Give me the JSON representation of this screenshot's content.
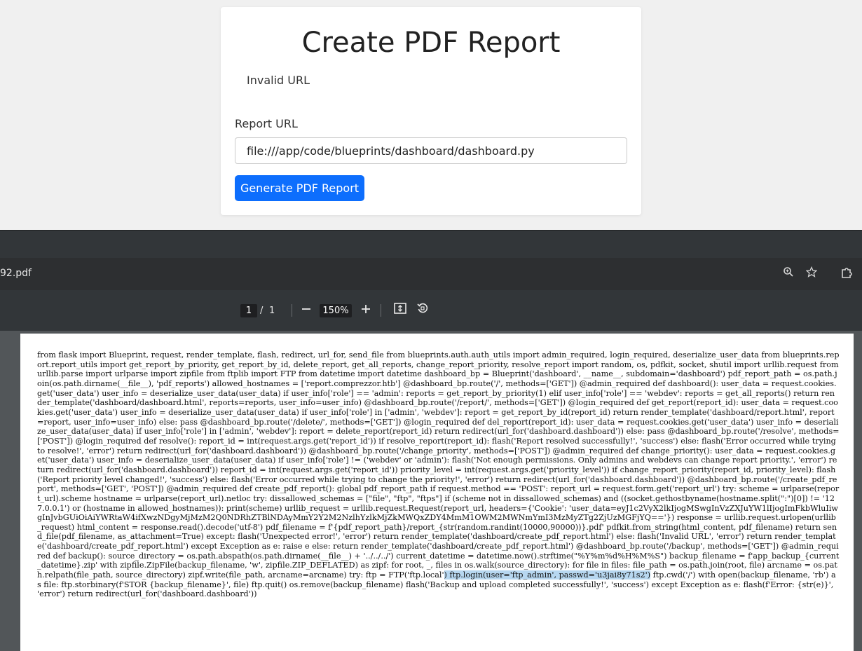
{
  "page": {
    "title": "Create PDF Report",
    "alert_text": "Invalid URL",
    "report_url_label": "Report URL",
    "report_url_value": "file:///app/code/blueprints/dashboard/dashboard.py",
    "generate_button_label": "Generate PDF Report",
    "accent_color": "#0d6efd"
  },
  "pdf_viewer": {
    "filename": "92.pdf",
    "current_page": "1",
    "page_separator": "/",
    "total_pages": "1",
    "zoom": "150%",
    "icons": [
      "zoom-icon",
      "star-icon",
      "extensions-icon",
      "zoom-out-icon",
      "zoom-in-icon",
      "fit-page-icon",
      "rotate-icon"
    ],
    "content_before_highlight": "from flask import Blueprint, request, render_template, flash, redirect, url_for, send_file from blueprints.auth.auth_utils import admin_required, login_required, deserialize_user_data from blueprints.report.report_utils import get_report_by_priority, get_report_by_id, delete_report, get_all_reports, change_report_priority, resolve_report import random, os, pdfkit, socket, shutil import urllib.request from urllib.parse import urlparse import zipfile from ftplib import FTP from datetime import datetime dashboard_bp = Blueprint('dashboard', __name__, subdomain='dashboard') pdf_report_path = os.path.join(os.path.dirname(__file__), 'pdf_reports') allowed_hostnames = ['report.comprezzor.htb'] @dashboard_bp.route('/', methods=['GET']) @admin_required def dashboard(): user_data = request.cookies.get('user_data') user_info = deserialize_user_data(user_data) if user_info['role'] == 'admin': reports = get_report_by_priority(1) elif user_info['role'] == 'webdev': reports = get_all_reports() return render_template('dashboard/dashboard.html', reports=reports, user_info=user_info) @dashboard_bp.route('/report/', methods=['GET']) @login_required def get_report(report_id): user_data = request.cookies.get('user_data') user_info = deserialize_user_data(user_data) if user_info['role'] in ['admin', 'webdev']: report = get_report_by_id(report_id) return render_template('dashboard/report.html', report=report, user_info=user_info) else: pass @dashboard_bp.route('/delete/', methods=['GET']) @login_required def del_report(report_id): user_data = request.cookies.get('user_data') user_info = deserialize_user_data(user_data) if user_info['role'] in ['admin', 'webdev']: report = delete_report(report_id) return redirect(url_for('dashboard.dashboard')) else: pass @dashboard_bp.route('/resolve', methods=['POST']) @login_required def resolve(): report_id = int(request.args.get('report_id')) if resolve_report(report_id): flash('Report resolved successfully!', 'success') else: flash('Error occurred while trying to resolve!', 'error') return redirect(url_for('dashboard.dashboard')) @dashboard_bp.route('/change_priority', methods=['POST']) @admin_required def change_priority(): user_data = request.cookies.get('user_data') user_info = deserialize_user_data(user_data) if user_info['role'] != ('webdev' or 'admin'): flash('Not enough permissions. Only admins and webdevs can change report priority.', 'error') return redirect(url_for('dashboard.dashboard')) report_id = int(request.args.get('report_id')) priority_level = int(request.args.get('priority_level')) if change_report_priority(report_id, priority_level): flash('Report priority level changed!', 'success') else: flash('Error occurred while trying to change the priority!', 'error') return redirect(url_for('dashboard.dashboard')) @dashboard_bp.route('/create_pdf_report', methods=['GET', 'POST']) @admin_required def create_pdf_report(): global pdf_report_path if request.method == 'POST': report_url = request.form.get('report_url') try: scheme = urlparse(report_url).scheme hostname = urlparse(report_url).netloc try: dissallowed_schemas = [\"file\", \"ftp\", \"ftps\"] if (scheme not in dissallowed_schemas) and ((socket.gethostbyname(hostname.split(\":\")[0]) != '127.0.0.1') or (hostname in allowed_hostnames)): print(scheme) urllib_request = urllib.request.Request(report_url, headers={'Cookie': 'user_data=eyJ1c2VyX2lkIjogMSwgInVzZXJuYW1lIjogImFkbWluIiwgInJvbGUiOiAiYWRtaW4ifXwzNDgyMjMzM2Q0NDRhZTBlNDAyMmY2Y2M2NzlhYzlkMjZkMWQxZDY4MmM1OWM2MWNmYmI3MzMyZTg2ZjUzMGFjYQ=='}) response = urllib.request.urlopen(urllib_request) html_content = response.read().decode('utf-8') pdf_filename = f'{pdf_report_path}/report_{str(random.randint(10000,90000))}.pdf' pdfkit.from_string(html_content, pdf_filename) return send_file(pdf_filename, as_attachment=True) except: flash('Unexpected error!', 'error') return render_template('dashboard/create_pdf_report.html') else: flash('Invalid URL', 'error') return render_template('dashboard/create_pdf_report.html') except Exception as e: raise e else: return render_template('dashboard/create_pdf_report.html') @dashboard_bp.route('/backup', methods=['GET']) @admin_required def backup(): source_directory = os.path.abspath(os.path.dirname(__file__) + '../../../') current_datetime = datetime.now().strftime(\"%Y%m%d%H%M%S\") backup_filename = f'app_backup_{current_datetime}.zip' with zipfile.ZipFile(backup_filename, 'w', zipfile.ZIP_DEFLATED) as zipf: for root, _, files in os.walk(source_directory): for file in files: file_path = os.path.join(root, file) arcname = os.path.relpath(file_path, source_directory) zipf.write(file_path, arcname=arcname) try: ftp = FTP('ftp.local'",
    "content_highlight": ") ftp.login(user='ftp_admin', passwd='u3jai8y71s2')",
    "content_after_highlight": " ftp.cwd('/') with open(backup_filename, 'rb') as file: ftp.storbinary(f'STOR {backup_filename}', file) ftp.quit() os.remove(backup_filename) flash('Backup and upload completed successfully!', 'success') except Exception as e: flash(f'Error: {str(e)}', 'error') return redirect(url_for('dashboard.dashboard'))"
  }
}
